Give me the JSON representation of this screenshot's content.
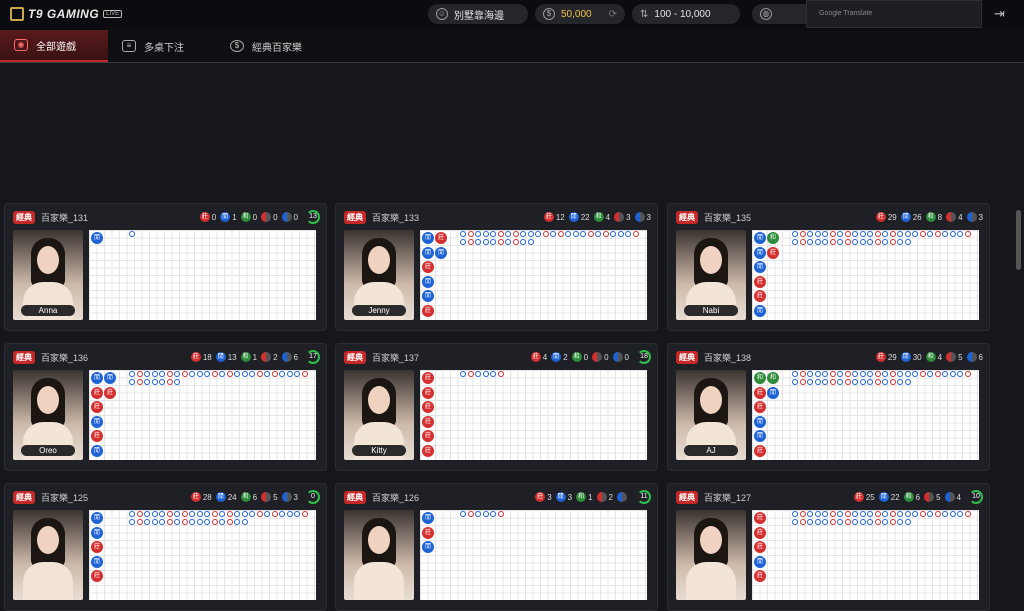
{
  "header": {
    "logo_text": "T9 GAMING",
    "live_badge": "LIVE",
    "username": "別墅靠海邊",
    "balance": "50,000",
    "bet_range": "100 - 10,000",
    "google_translate": "Google Translate"
  },
  "nav": {
    "tabs": [
      {
        "label": "全部遊戲"
      },
      {
        "label": "多桌下注"
      },
      {
        "label": "經典百家樂"
      }
    ]
  },
  "tables": [
    {
      "tag": "經典",
      "name": "百家樂_131",
      "banker": "0",
      "player": "1",
      "tie": "0",
      "banker_pair": "0",
      "player_pair": "0",
      "timer": "13",
      "dealer": "Anna",
      "bead": [
        "閒"
      ]
    },
    {
      "tag": "經典",
      "name": "百家樂_133",
      "banker": "12",
      "player": "22",
      "tie": "4",
      "banker_pair": "3",
      "player_pair": "3",
      "timer": "",
      "dealer": "Jenny",
      "bead": [
        "閒",
        "閒",
        "莊",
        "閒",
        "閒",
        "莊",
        "莊",
        "閒"
      ]
    },
    {
      "tag": "經典",
      "name": "百家樂_135",
      "banker": "29",
      "player": "26",
      "tie": "8",
      "banker_pair": "4",
      "player_pair": "3",
      "timer": "",
      "dealer": "Nabi",
      "bead": [
        "閒",
        "閒",
        "閒",
        "莊",
        "莊",
        "閒",
        "和",
        "莊"
      ]
    },
    {
      "tag": "經典",
      "name": "百家樂_136",
      "banker": "18",
      "player": "13",
      "tie": "1",
      "banker_pair": "2",
      "player_pair": "6",
      "timer": "17",
      "dealer": "Oreo",
      "bead": [
        "閒",
        "莊",
        "莊",
        "閒",
        "莊",
        "閒",
        "閒",
        "莊"
      ]
    },
    {
      "tag": "經典",
      "name": "百家樂_137",
      "banker": "4",
      "player": "2",
      "tie": "0",
      "banker_pair": "0",
      "player_pair": "0",
      "timer": "18",
      "dealer": "Kitty",
      "bead": [
        "莊",
        "莊",
        "莊",
        "莊",
        "莊",
        "莊"
      ]
    },
    {
      "tag": "經典",
      "name": "百家樂_138",
      "banker": "29",
      "player": "30",
      "tie": "4",
      "banker_pair": "5",
      "player_pair": "6",
      "timer": "",
      "dealer": "AJ",
      "bead": [
        "和",
        "莊",
        "莊",
        "閒",
        "閒",
        "莊",
        "和",
        "閒"
      ]
    },
    {
      "tag": "經典",
      "name": "百家樂_125",
      "banker": "28",
      "player": "24",
      "tie": "6",
      "banker_pair": "5",
      "player_pair": "3",
      "timer": "0",
      "dealer": "",
      "bead": [
        "閒",
        "閒",
        "莊",
        "閒",
        "莊"
      ]
    },
    {
      "tag": "經典",
      "name": "百家樂_126",
      "banker": "3",
      "player": "3",
      "tie": "1",
      "banker_pair": "2",
      "player_pair": "",
      "timer": "11",
      "dealer": "",
      "bead": [
        "閒",
        "莊",
        "閒"
      ]
    },
    {
      "tag": "經典",
      "name": "百家樂_127",
      "banker": "25",
      "player": "22",
      "tie": "6",
      "banker_pair": "5",
      "player_pair": "4",
      "timer": "10",
      "dealer": "",
      "bead": [
        "莊",
        "莊",
        "莊",
        "閒",
        "莊"
      ]
    }
  ],
  "colors": {
    "banker": "#d32f2f",
    "player": "#1e63d6",
    "tie": "#2e8b3a",
    "accent": "#c62828"
  },
  "icons": {
    "user": "user-icon",
    "coin": "coin-icon",
    "range": "updown-icon",
    "globe": "globe-icon",
    "logout": "logout-icon"
  }
}
